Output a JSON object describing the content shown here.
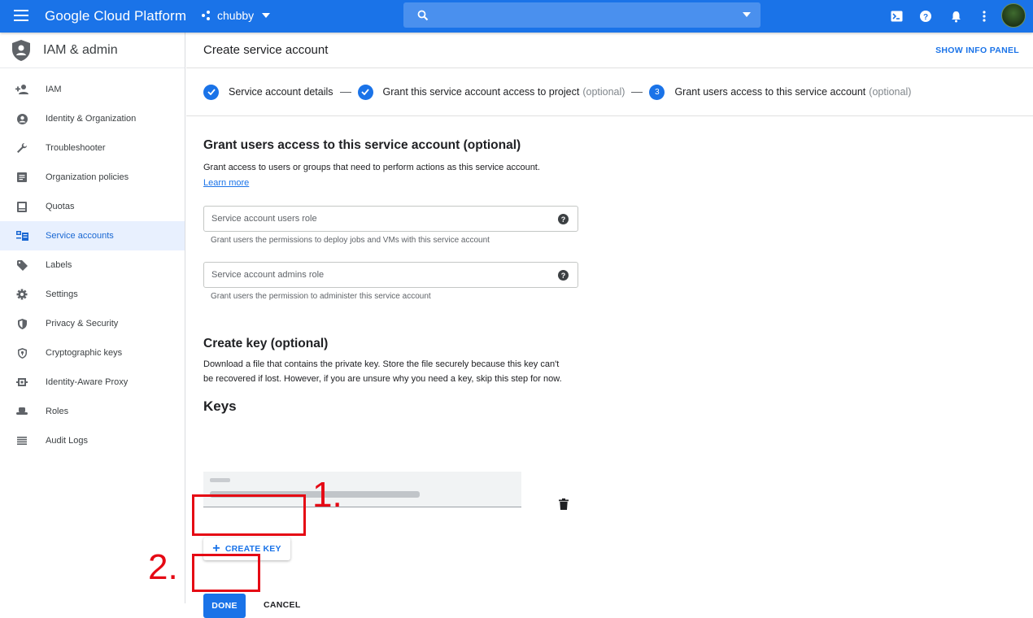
{
  "topbar": {
    "brand": "Google Cloud Platform",
    "project": "chubby",
    "avatar_color": "#2f5524"
  },
  "sidebar": {
    "title": "IAM & admin",
    "items": [
      {
        "label": "IAM",
        "icon": "person-add-icon"
      },
      {
        "label": "Identity & Organization",
        "icon": "account-circle-icon"
      },
      {
        "label": "Troubleshooter",
        "icon": "wrench-icon"
      },
      {
        "label": "Organization policies",
        "icon": "policy-doc-icon"
      },
      {
        "label": "Quotas",
        "icon": "quota-icon"
      },
      {
        "label": "Service accounts",
        "icon": "service-account-icon",
        "active": true
      },
      {
        "label": "Labels",
        "icon": "label-tag-icon"
      },
      {
        "label": "Settings",
        "icon": "gear-icon"
      },
      {
        "label": "Privacy & Security",
        "icon": "shield-icon"
      },
      {
        "label": "Cryptographic keys",
        "icon": "shield-key-icon"
      },
      {
        "label": "Identity-Aware Proxy",
        "icon": "proxy-icon"
      },
      {
        "label": "Roles",
        "icon": "roles-hat-icon"
      },
      {
        "label": "Audit Logs",
        "icon": "list-icon"
      }
    ]
  },
  "main": {
    "title": "Create service account",
    "info_panel": "SHOW INFO PANEL",
    "steps": [
      {
        "label": "Service account details",
        "optional": "",
        "state": "done"
      },
      {
        "label": "Grant this service account access to project",
        "optional": "(optional)",
        "state": "done"
      },
      {
        "label": "Grant users access to this service account",
        "optional": "(optional)",
        "state": "current",
        "number": "3"
      }
    ]
  },
  "grant": {
    "heading": "Grant users access to this service account (optional)",
    "desc": "Grant access to users or groups that need to perform actions as this service account.",
    "learn_more": "Learn more",
    "users_role_placeholder": "Service account users role",
    "users_role_hint": "Grant users the permissions to deploy jobs and VMs with this service account",
    "admins_role_placeholder": "Service account admins role",
    "admins_role_hint": "Grant users the permission to administer this service account"
  },
  "key": {
    "heading": "Create key (optional)",
    "desc": "Download a file that contains the private key. Store the file securely because this key can't be recovered if lost. However, if you are unsure why you need a key, skip this step for now.",
    "keys_heading": "Keys",
    "create_key": "CREATE KEY",
    "done": "DONE",
    "cancel": "CANCEL"
  },
  "annotations": {
    "one": "1.",
    "two": "2.",
    "color": "#e50914"
  }
}
